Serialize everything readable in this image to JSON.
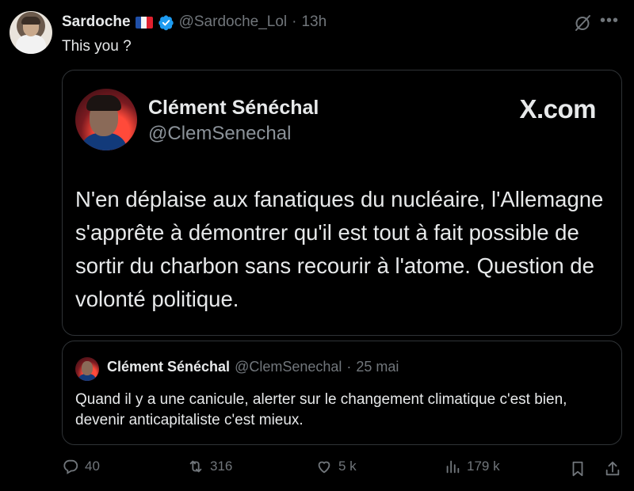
{
  "tweet": {
    "author_name": "Sardoche",
    "author_handle": "@Sardoche_Lol",
    "separator": "·",
    "time": "13h",
    "text": "This you ?"
  },
  "embedded_card": {
    "name": "Clément Sénéchal",
    "handle": "@ClemSenechal",
    "site": "X.com",
    "text": "N'en déplaise aux fanatiques du nucléaire, l'Allemagne s'apprête à démontrer qu'il est tout à fait possible de sortir du charbon sans recourir à l'atome. Question de volonté politique."
  },
  "quoted_tweet": {
    "name": "Clément Sénéchal",
    "handle": "@ClemSenechal",
    "separator": "·",
    "date": "25 mai",
    "text": "Quand il y a une canicule, alerter sur le changement climatique c'est bien, devenir anticapitaliste c'est mieux."
  },
  "actions": {
    "replies": "40",
    "reposts": "316",
    "likes": "5 k",
    "views": "179 k"
  },
  "colors": {
    "background": "#000000",
    "text": "#e7e9ea",
    "muted": "#71767b",
    "border": "#2f3336",
    "verified": "#1d9bf0"
  },
  "icons": [
    "verified-badge-icon",
    "french-flag-icon",
    "grok-icon",
    "more-icon",
    "reply-icon",
    "repost-icon",
    "like-icon",
    "views-icon",
    "bookmark-icon",
    "share-icon"
  ]
}
